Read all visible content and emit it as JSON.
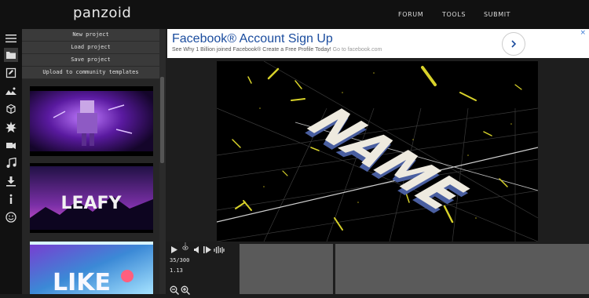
{
  "app": {
    "logo": "panzoid"
  },
  "nav": {
    "items": [
      "FORUM",
      "TOOLS",
      "SUBMIT"
    ]
  },
  "panel": {
    "buttons": [
      "New project",
      "Load project",
      "Save project",
      "Upload to community templates"
    ],
    "templates": [
      {
        "caption": ""
      },
      {
        "caption": "LEAFY"
      },
      {
        "caption": "LIKE"
      }
    ]
  },
  "ad": {
    "title": "Facebook® Account Sign Up",
    "subtitle": "See Why 1 Billion joined Facebook® Create a Free Profile Today!",
    "link": "Go to facebook.com",
    "close": "×"
  },
  "preview": {
    "text": "NAME"
  },
  "timeline": {
    "frame": "35/300",
    "time": "1.13"
  },
  "icons": {
    "sidebar": [
      "menu-icon",
      "folder-icon",
      "edit-icon",
      "landscape-icon",
      "cube-icon",
      "burst-icon",
      "camera-icon",
      "music-icon",
      "download-icon",
      "info-icon",
      "smiley-icon"
    ],
    "controls": [
      "play-icon",
      "eye-icon",
      "volume-icon",
      "step-icon",
      "waveform-icon"
    ],
    "zoom": [
      "zoom-out-icon",
      "zoom-in-icon"
    ]
  },
  "colors": {
    "accent": "#1a4c9e",
    "background": "#1c1c1c",
    "stars": "#d8d22a"
  }
}
